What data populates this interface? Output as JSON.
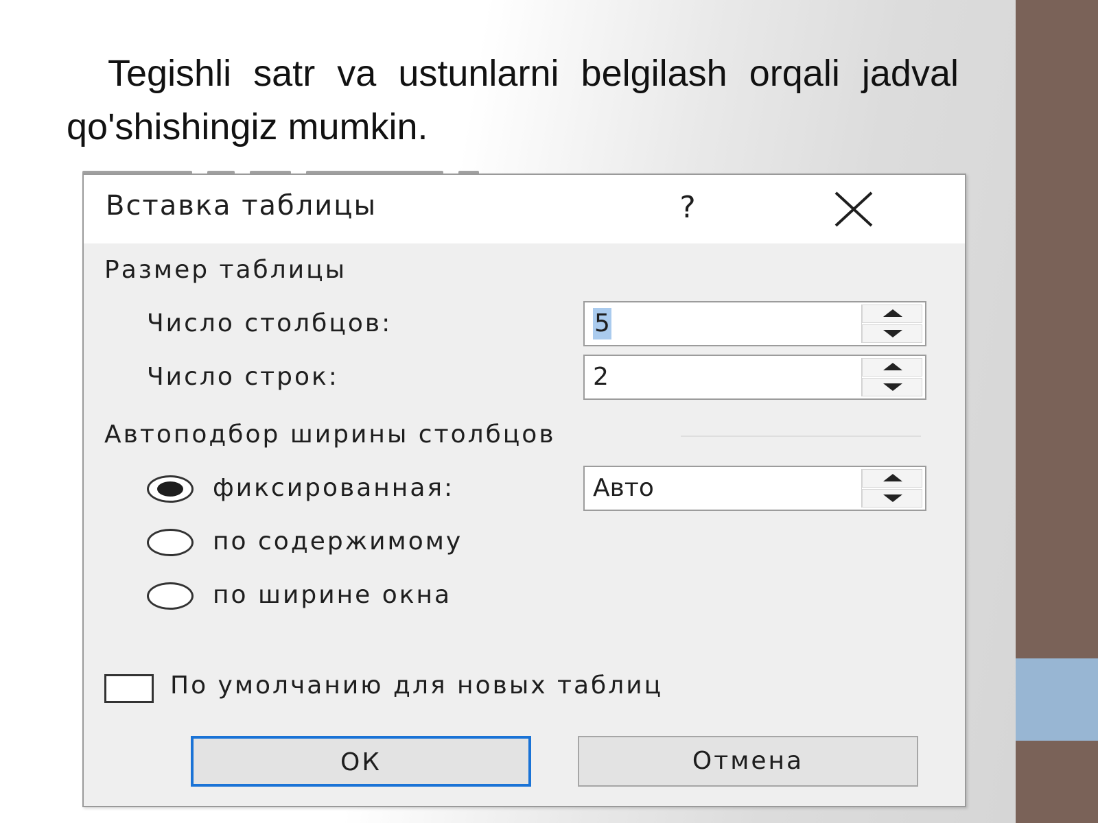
{
  "slide": {
    "text": "Tegishli satr va ustunlarni belgilash orqali jadval qo'shishingiz mumkin."
  },
  "dialog": {
    "title": "Вставка таблицы",
    "help_label": "?",
    "size_section": "Размер таблицы",
    "columns_label": "Число столбцов:",
    "columns_value": "5",
    "rows_label": "Число строк:",
    "rows_value": "2",
    "autofit_section": "Автоподбор ширины столбцов",
    "fixed_label": "фиксированная:",
    "fixed_value": "Авто",
    "content_label": "по содержимому",
    "window_label": "по ширине окна",
    "default_label": "По умолчанию для новых таблиц",
    "ok_label": "ОК",
    "cancel_label": "Отмена"
  },
  "state": {
    "autofit_selected": "fixed",
    "default_checked": false
  },
  "colors": {
    "side_bar": "#7a6258",
    "side_accent": "#98b6d3",
    "ok_focus_border": "#1a73d6",
    "selection": "#aacbee"
  }
}
